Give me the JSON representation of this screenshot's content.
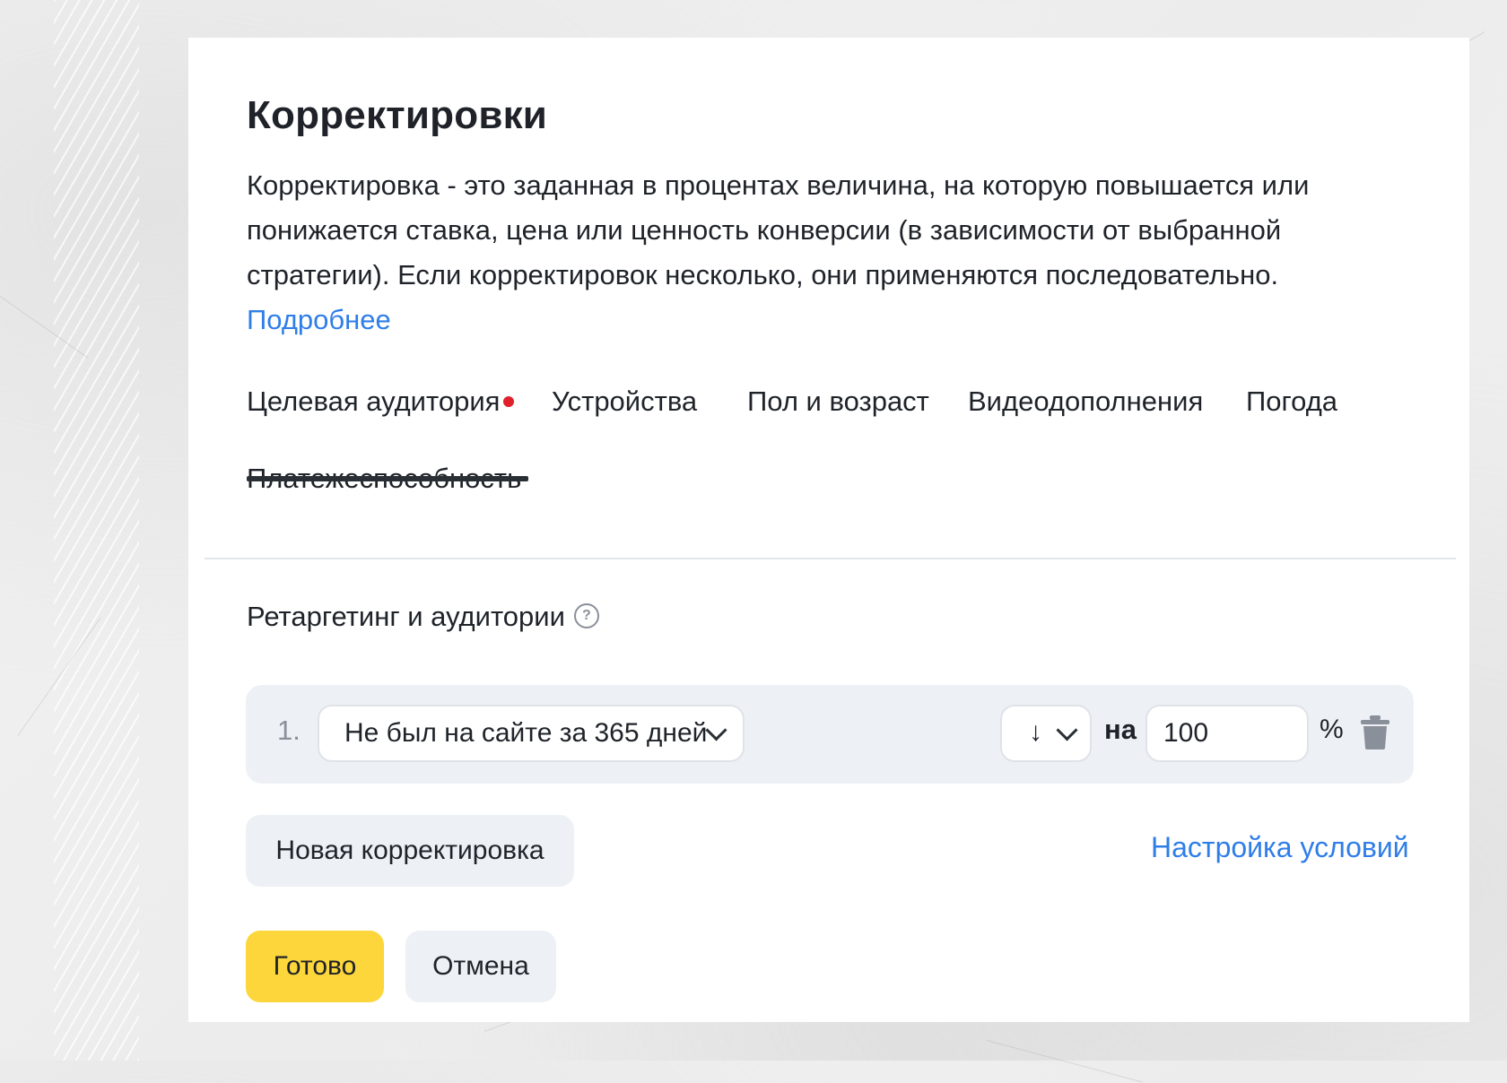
{
  "dialog": {
    "title": "Корректировки",
    "description": "Корректировка - это заданная в процентах величина, на которую повышается или понижается ставка, цена или ценность конверсии (в зависимости от выбранной стратегии). Если корректировок несколько, они применяются последовательно.",
    "more_link": "Подробнее"
  },
  "tabs": [
    {
      "label": "Целевая аудитория",
      "active": true,
      "has_alert_dot": true
    },
    {
      "label": "Устройства",
      "active": false
    },
    {
      "label": "Пол и возраст",
      "active": false
    },
    {
      "label": "Видеодополнения",
      "active": false
    },
    {
      "label": "Погода",
      "active": false
    },
    {
      "label": "Платежеспособность",
      "active": false
    }
  ],
  "section": {
    "label": "Ретаргетинг и аудитории",
    "help_icon": "?"
  },
  "adjustments": [
    {
      "index": "1.",
      "audience": "Не был на сайте за 365 дней",
      "direction": "↓",
      "na_label": "на",
      "value": "100",
      "unit": "%"
    }
  ],
  "actions": {
    "new_adjustment": "Новая корректировка",
    "conditions_link": "Настройка условий",
    "done": "Готово",
    "cancel": "Отмена"
  },
  "colors": {
    "accent_link": "#2f7ee8",
    "primary_button": "#fcd63a",
    "alert_dot": "#e0202b",
    "row_background": "#edf0f5"
  },
  "icons": {
    "help": "question-circle-icon",
    "delete": "trash-icon",
    "dropdown": "chevron-down-icon"
  }
}
